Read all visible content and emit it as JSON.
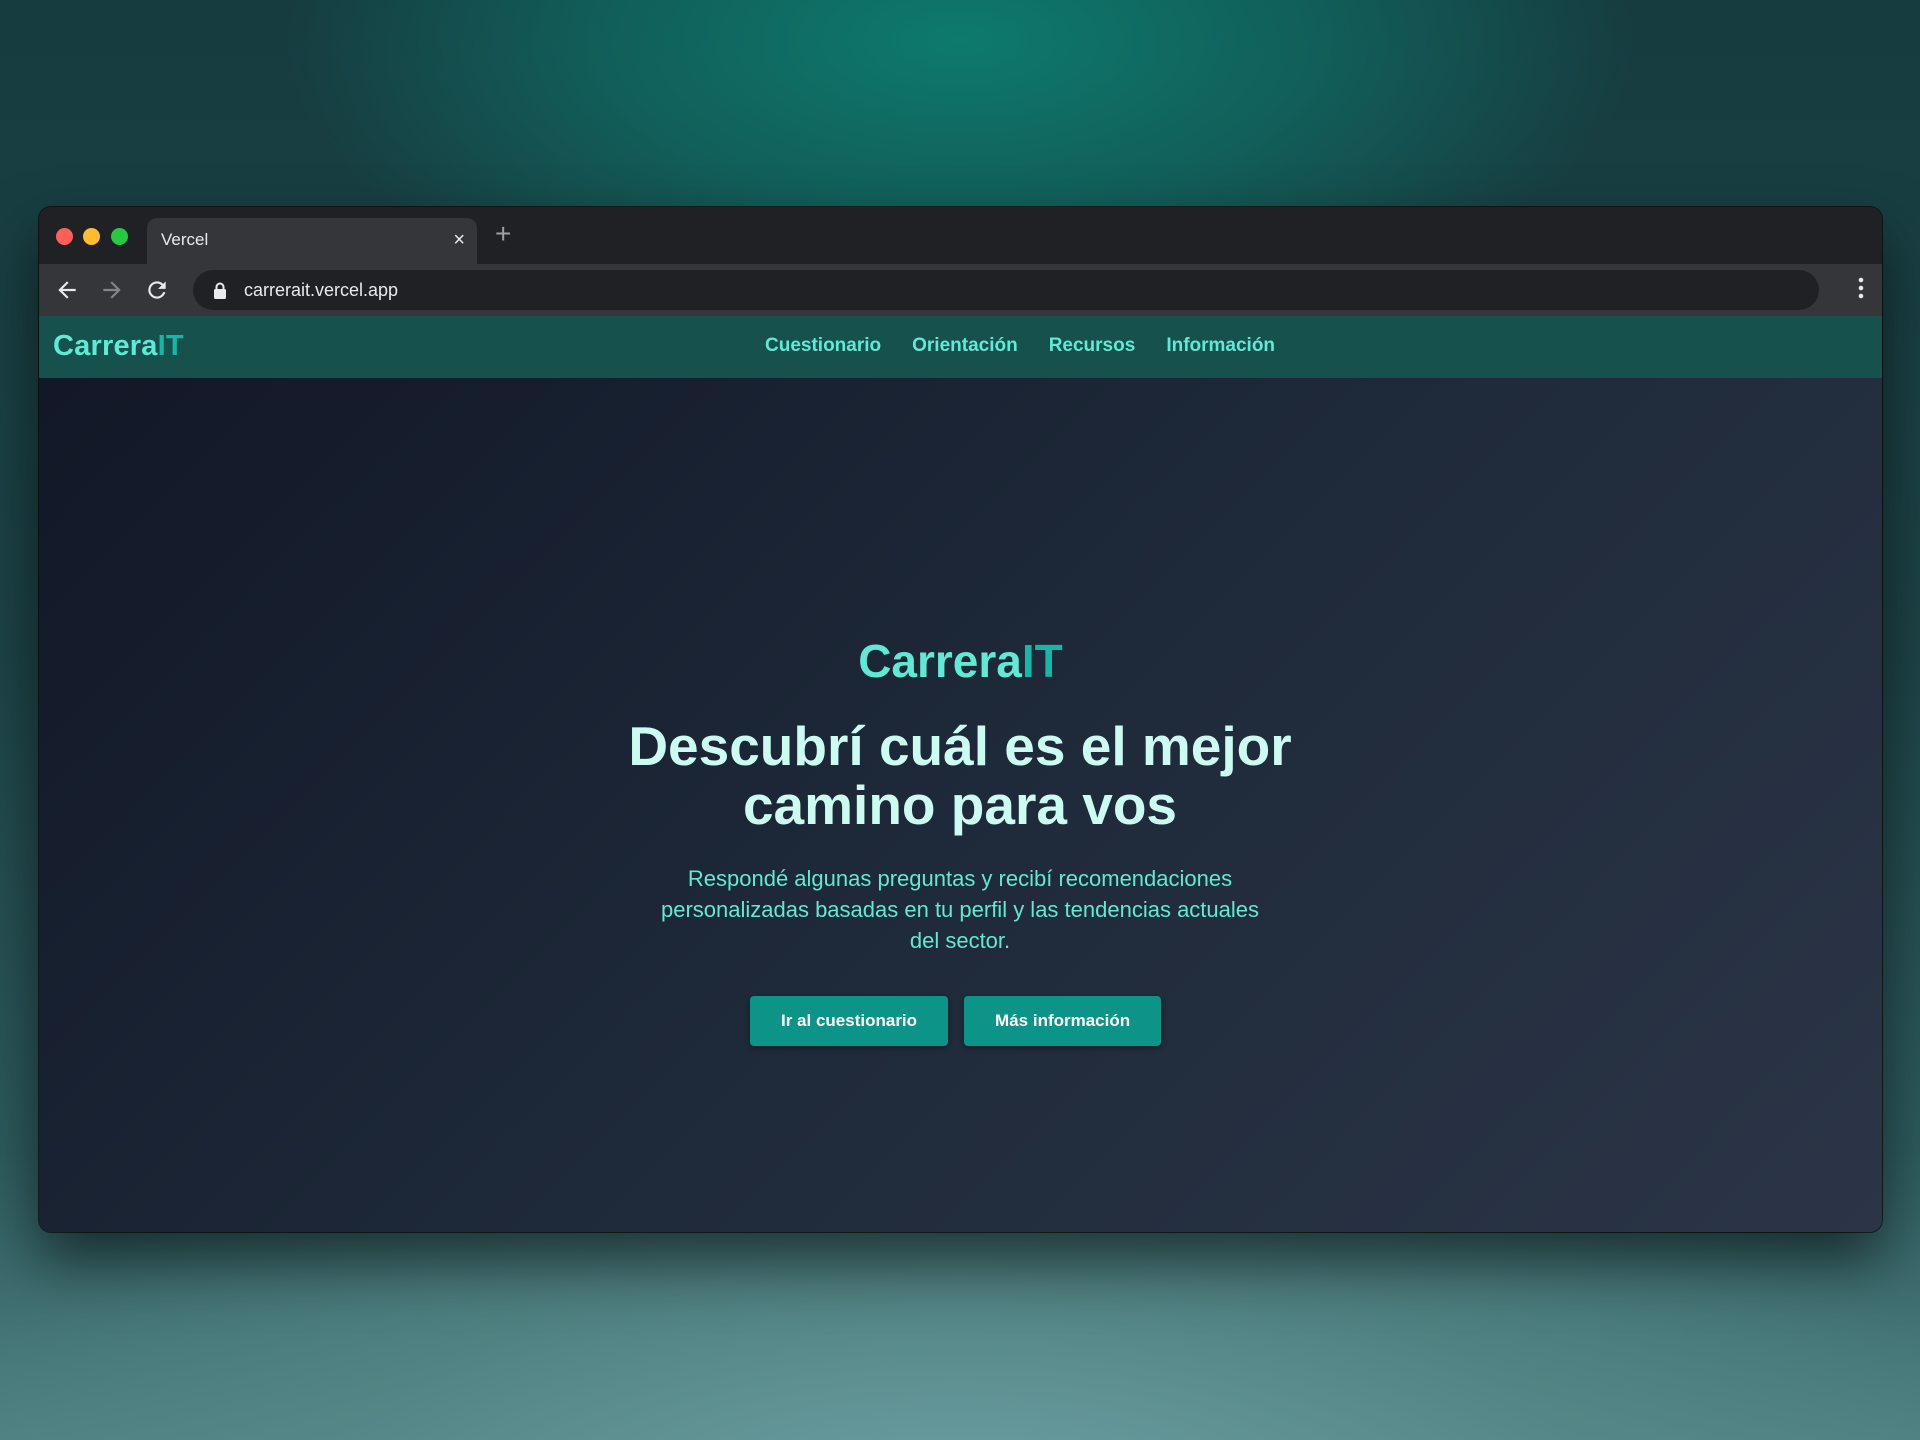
{
  "browser": {
    "tab_title": "Vercel",
    "tab_close": "×",
    "new_tab": "+",
    "url": "carrerait.vercel.app"
  },
  "site": {
    "brand_main": "Carrera",
    "brand_accent": "IT",
    "nav": [
      "Cuestionario",
      "Orientación",
      "Recursos",
      "Información"
    ]
  },
  "hero": {
    "brand_main": "Carrera",
    "brand_accent": "IT",
    "title": "Descubrí cuál es el mejor camino para vos",
    "subtitle": "Respondé algunas preguntas y recibí recomendaciones personalizadas basadas en tu perfil y las tendencias actuales del sector.",
    "primary_button": "Ir al cuestionario",
    "secondary_button": "Más información"
  },
  "colors": {
    "accent": "#5eead4",
    "accent_dark": "#14b8a6",
    "button": "#0d9488",
    "nav_bg": "#17514d"
  },
  "icons": [
    "back-arrow-icon",
    "forward-arrow-icon",
    "reload-icon",
    "lock-icon",
    "more-vert-icon",
    "close-icon",
    "plus-icon"
  ]
}
